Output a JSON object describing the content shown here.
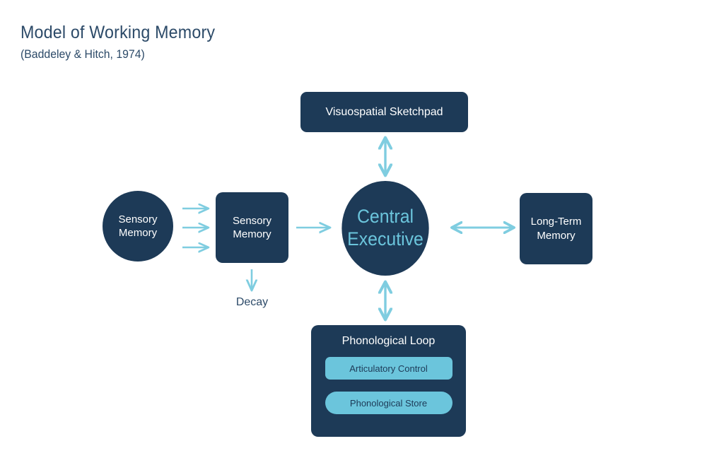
{
  "header": {
    "title": "Model of Working Memory",
    "subtitle": "(Baddeley & Hitch, 1974)"
  },
  "colors": {
    "background": "#ffffff",
    "node_fill": "#1d3a57",
    "accent_light_blue": "#6BC5DC",
    "arrow": "#7FCDE0",
    "title_text": "#2c4a68",
    "node_text": "#ffffff"
  },
  "diagram": {
    "type": "flow-diagram",
    "nodes": [
      {
        "id": "sensory-memory-circle",
        "label": "Sensory Memory",
        "shape": "circle",
        "fill": "#1d3a57",
        "text_color": "#ffffff"
      },
      {
        "id": "sensory-memory-box",
        "label": "Sensory Memory",
        "shape": "rounded-square",
        "fill": "#1d3a57",
        "text_color": "#ffffff"
      },
      {
        "id": "central-executive",
        "label": "Central Executive",
        "shape": "circle",
        "fill": "#1d3a57",
        "text_color": "#6BC5DC"
      },
      {
        "id": "visuospatial-sketchpad",
        "label": "Visuospatial Sketchpad",
        "shape": "rounded-rect",
        "fill": "#1d3a57",
        "text_color": "#ffffff"
      },
      {
        "id": "long-term-memory",
        "label": "Long-Term Memory",
        "shape": "rounded-square",
        "fill": "#1d3a57",
        "text_color": "#ffffff"
      },
      {
        "id": "phonological-loop",
        "label": "Phonological Loop",
        "shape": "rounded-rect",
        "fill": "#1d3a57",
        "text_color": "#ffffff",
        "children": [
          {
            "id": "articulatory-control",
            "label": "Articulatory Control",
            "shape": "rounded-rect",
            "fill": "#6BC5DC",
            "text_color": "#1d3a57"
          },
          {
            "id": "phonological-store",
            "label": "Phonological Store",
            "shape": "pill",
            "fill": "#6BC5DC",
            "text_color": "#1d3a57"
          }
        ]
      }
    ],
    "labels": [
      {
        "id": "decay",
        "text": "Decay"
      }
    ],
    "edges": [
      {
        "from": "sensory-memory-circle",
        "to": "sensory-memory-box",
        "direction": "one-way",
        "count": 3
      },
      {
        "from": "sensory-memory-box",
        "to": "central-executive",
        "direction": "one-way"
      },
      {
        "from": "sensory-memory-box",
        "to": "decay",
        "direction": "one-way"
      },
      {
        "from": "central-executive",
        "to": "visuospatial-sketchpad",
        "direction": "two-way"
      },
      {
        "from": "central-executive",
        "to": "phonological-loop",
        "direction": "two-way"
      },
      {
        "from": "central-executive",
        "to": "long-term-memory",
        "direction": "two-way"
      }
    ]
  }
}
